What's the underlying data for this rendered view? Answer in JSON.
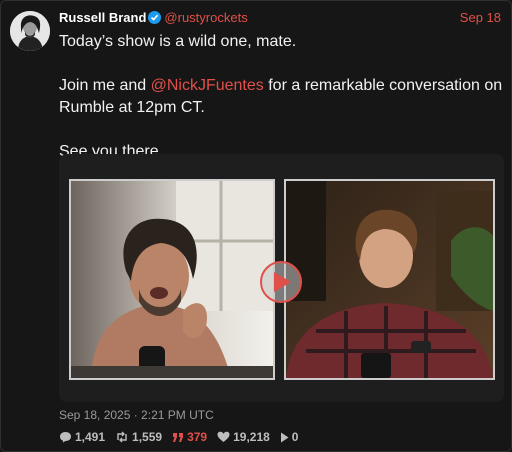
{
  "post": {
    "author_name": "Russell Brand",
    "handle": "@rustyrockets",
    "date": "Sep 18",
    "line1": "Today’s show is a wild one, mate.",
    "line2_prefix": "Join me and ",
    "mention": "@NickJFuentes",
    "line2_suffix": " for a remarkable conversation on Rumble at 12pm CT.",
    "line3": "See you there.",
    "timestamp": "Sep 18, 2025 · 2:21 PM UTC"
  },
  "media": {
    "type": "video",
    "play_icon": "play-icon"
  },
  "stats": {
    "replies": "1,491",
    "reposts": "1,559",
    "quotes": "379",
    "likes": "19,218",
    "views": "0"
  },
  "colors": {
    "accent": "#e0504a",
    "verified": "#1d9bf0",
    "background": "#161616"
  }
}
